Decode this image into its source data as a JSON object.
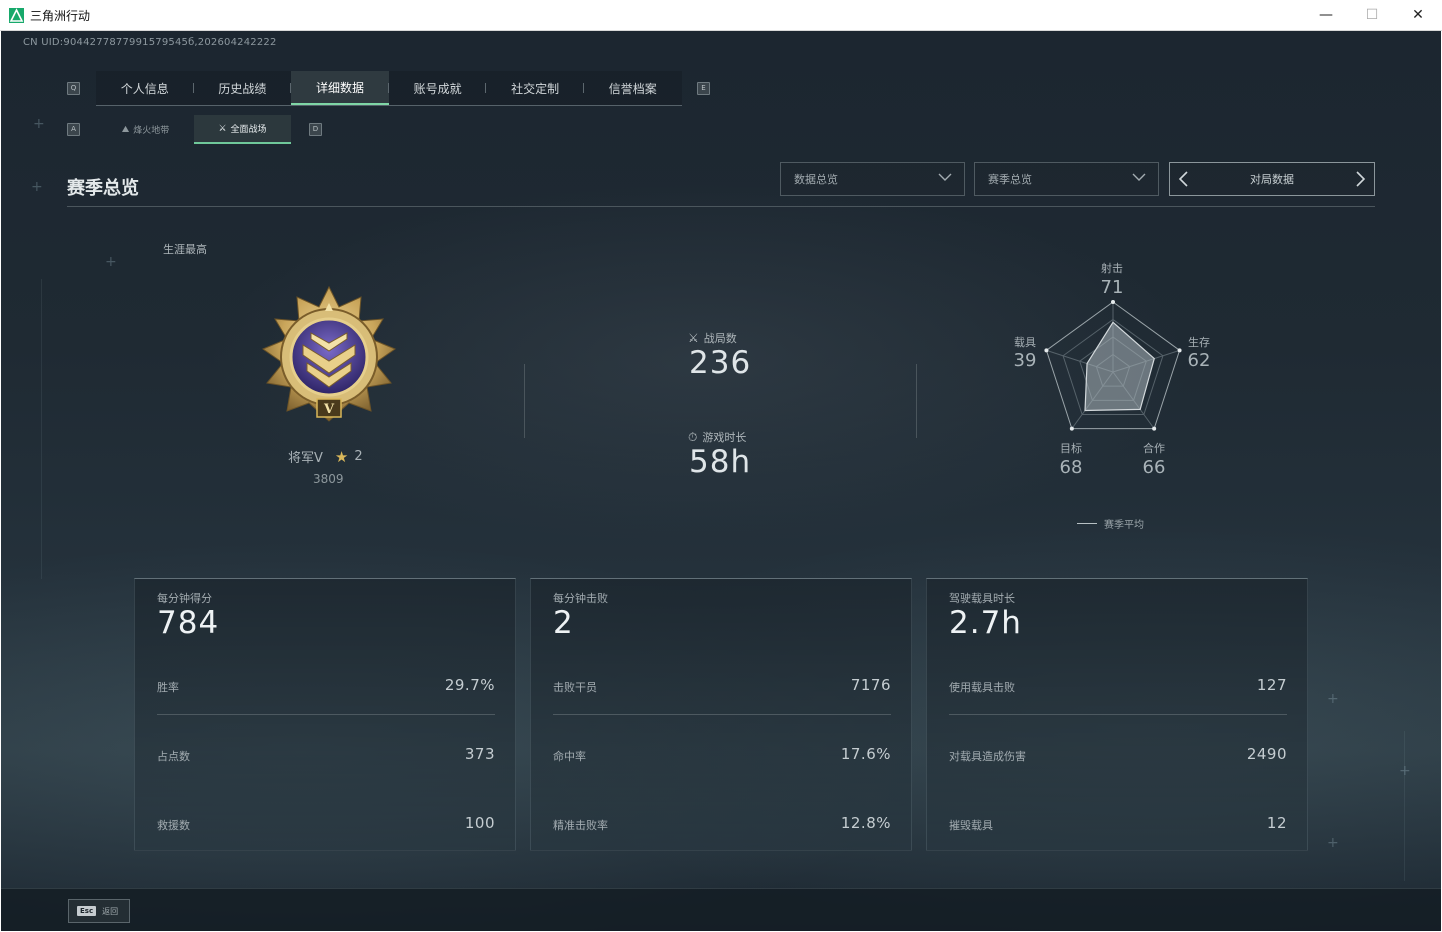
{
  "window": {
    "title": "三角洲行动",
    "min_glyph": "—",
    "max_glyph": "☐",
    "close_glyph": "✕"
  },
  "uid": "CN UID:9044277877991579545б,202604242222",
  "top_tabs": {
    "left_key": "Q",
    "right_key": "E",
    "items": [
      "个人信息",
      "历史战绩",
      "详细数据",
      "账号成就",
      "社交定制",
      "信誉档案"
    ],
    "active_index": 2
  },
  "sub_tabs": {
    "left_key": "A",
    "right_key": "D",
    "items": [
      {
        "label": "烽火地带",
        "icon": "flame-zone-icon",
        "glyph": "⛰"
      },
      {
        "label": "全面战场",
        "icon": "battlefield-icon",
        "glyph": "⚔"
      }
    ],
    "active_index": 1
  },
  "section": {
    "title": "赛季总览"
  },
  "filters": {
    "dropdown1": "数据总览",
    "dropdown2": "赛季总览",
    "pager": "对局数据"
  },
  "rank": {
    "career_label": "生涯最高",
    "name": "将军V",
    "stars": "2",
    "score": "3809",
    "medal_numeral": "V"
  },
  "middle": {
    "matches_label": "战局数",
    "matches_icon": "crossed-swords-icon",
    "matches_value": "236",
    "time_label": "游戏时长",
    "time_icon": "stopwatch-icon",
    "time_value": "58h"
  },
  "radar": {
    "axes": [
      {
        "label": "射击",
        "value": "71"
      },
      {
        "label": "生存",
        "value": "62"
      },
      {
        "label": "合作",
        "value": "66"
      },
      {
        "label": "目标",
        "value": "68"
      },
      {
        "label": "载具",
        "value": "39"
      }
    ],
    "levels": [
      71,
      62,
      66,
      68,
      39
    ],
    "legend": "赛季平均"
  },
  "cards": [
    {
      "label": "每分钟得分",
      "value": "784",
      "rows": [
        {
          "label": "胜率",
          "value": "29.7%"
        },
        {
          "label": "占点数",
          "value": "373"
        },
        {
          "label": "救援数",
          "value": "100"
        }
      ]
    },
    {
      "label": "每分钟击败",
      "value": "2",
      "rows": [
        {
          "label": "击败干员",
          "value": "7176"
        },
        {
          "label": "命中率",
          "value": "17.6%"
        },
        {
          "label": "精准击败率",
          "value": "12.8%"
        }
      ]
    },
    {
      "label": "驾驶载具时长",
      "value": "2.7h",
      "rows": [
        {
          "label": "使用载具击败",
          "value": "127"
        },
        {
          "label": "对载具造成伤害",
          "value": "2490"
        },
        {
          "label": "摧毁载具",
          "value": "12"
        }
      ]
    }
  ],
  "footer": {
    "esc_key": "Esc",
    "back_label": "返回"
  },
  "colors": {
    "accent": "#7fd6a6",
    "gold": "#d9b75a",
    "medal_purple": "#4b3d8a"
  }
}
